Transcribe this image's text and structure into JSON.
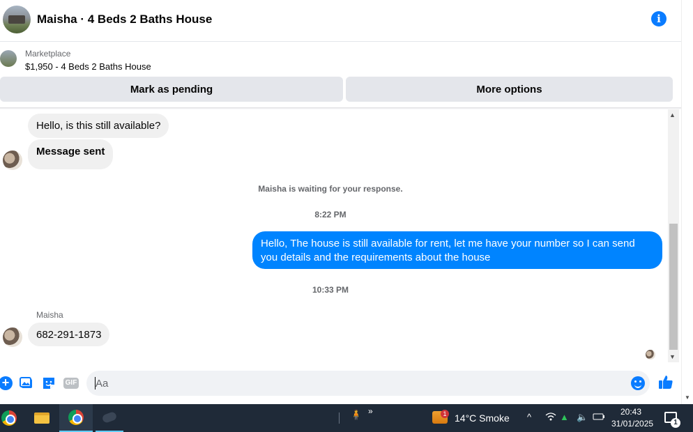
{
  "header": {
    "title": "Maisha · 4 Beds 2 Baths House",
    "info_icon": "info-icon"
  },
  "listing": {
    "source": "Marketplace",
    "summary": "$1,950 - 4 Beds 2 Baths House"
  },
  "actions": {
    "mark_pending": "Mark as pending",
    "more_options": "More options"
  },
  "messages": [
    {
      "from": "Maisha",
      "text": "Hello, is this still available?"
    },
    {
      "from": "Maisha",
      "text": "Message sent"
    },
    {
      "status": "Maisha is waiting for your response."
    },
    {
      "time": "8:22 PM"
    },
    {
      "from": "me",
      "text": "Hello, The house is still available for rent, let me have your number so I can send you details and the requirements about the house"
    },
    {
      "time": "10:33 PM"
    },
    {
      "sender_label": "Maisha"
    },
    {
      "from": "Maisha",
      "text": "682-291-1873"
    }
  ],
  "composer": {
    "placeholder": "Aa",
    "gif_label": "GIF"
  },
  "colors": {
    "accent": "#0a7cff",
    "outgoing_bubble": "#0084ff",
    "incoming_bubble": "#f0f0f0",
    "taskbar": "#1f2a38"
  },
  "taskbar": {
    "weather_badge": "1",
    "weather": "14°C  Smoke",
    "chevron": "»",
    "time": "20:43",
    "date": "31/01/2025",
    "notification_count": "1"
  }
}
